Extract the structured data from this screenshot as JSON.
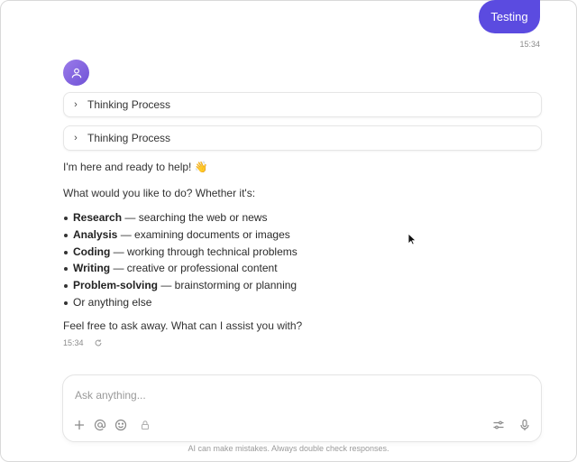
{
  "conversation": {
    "user_message": {
      "text": "Testing",
      "time": "15:34"
    },
    "assistant": {
      "thinking_blocks": [
        {
          "label": "Thinking Process"
        },
        {
          "label": "Thinking Process"
        }
      ],
      "greeting": "I'm here and ready to help! 👋",
      "prompt": "What would you like to do? Whether it's:",
      "options": [
        {
          "bold": "Research",
          "rest": " — searching the web or news"
        },
        {
          "bold": "Analysis",
          "rest": " — examining documents or images"
        },
        {
          "bold": "Coding",
          "rest": " — working through technical problems"
        },
        {
          "bold": "Writing",
          "rest": " — creative or professional content"
        },
        {
          "bold": "Problem-solving",
          "rest": " — brainstorming or planning"
        },
        {
          "bold": "",
          "rest": "Or anything else"
        }
      ],
      "closing": "Feel free to ask away. What can I assist you with?",
      "time": "15:34"
    }
  },
  "composer": {
    "placeholder": "Ask anything...",
    "value": "",
    "tools_left": [
      "plus-icon",
      "at-icon",
      "emoji-icon",
      "lock-icon"
    ],
    "tools_right": [
      "settings-sliders-icon",
      "microphone-icon"
    ]
  },
  "footer": {
    "disclaimer": "AI can make mistakes. Always double check responses."
  },
  "colors": {
    "accent": "#5b4be0",
    "avatar": "#8a6be6"
  }
}
